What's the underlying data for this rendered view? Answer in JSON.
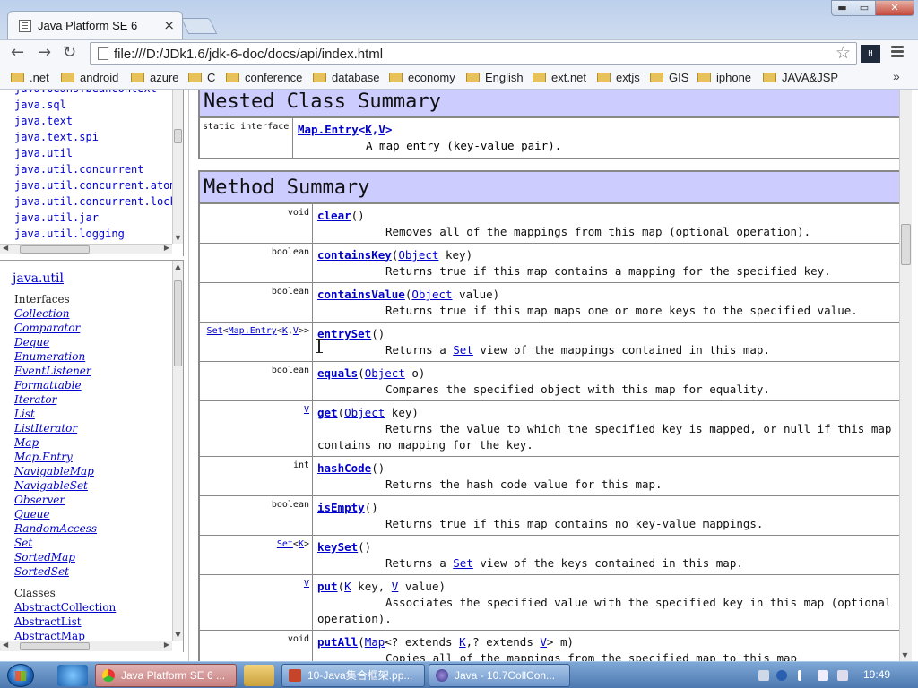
{
  "browser": {
    "tab_title": "Java Platform SE 6",
    "tab_close": "×",
    "url": "file:///D:/JDk1.6/jdk-6-doc/docs/api/index.html",
    "window_controls": {
      "min": "▬",
      "max": "▭",
      "close": "✕"
    },
    "nav": {
      "back": "←",
      "forward": "→",
      "reload": "↻"
    },
    "star": "☆",
    "ext_label": "H",
    "bookmarks": [
      ".net",
      "android",
      "azure",
      "C",
      "conference",
      "database",
      "economy",
      "English",
      "ext.net",
      "extjs",
      "GIS",
      "iphone",
      "JAVA&JSP"
    ],
    "bookmarks_more": "»"
  },
  "packages": {
    "items": [
      "java.beans.beancontext",
      "java.sql",
      "java.text",
      "java.text.spi",
      "java.util",
      "java.util.concurrent",
      "java.util.concurrent.atomic",
      "java.util.concurrent.locks",
      "java.util.jar",
      "java.util.logging"
    ]
  },
  "classes": {
    "package_title": "java.util",
    "interfaces_heading": "Interfaces",
    "interfaces": [
      "Collection",
      "Comparator",
      "Deque",
      "Enumeration",
      "EventListener",
      "Formattable",
      "Iterator",
      "List",
      "ListIterator",
      "Map",
      "Map.Entry",
      "NavigableMap",
      "NavigableSet",
      "Observer",
      "Queue",
      "RandomAccess",
      "Set",
      "SortedMap",
      "SortedSet"
    ],
    "classes_heading": "Classes",
    "classes": [
      "AbstractCollection",
      "AbstractList",
      "AbstractMap"
    ]
  },
  "nested": {
    "heading": "Nested Class Summary",
    "type": "static interface",
    "name": "Map.Entry",
    "generic_open": "<",
    "k": "K",
    "comma": ",",
    "v": "V",
    "generic_close": ">",
    "desc": "A map entry (key-value pair)."
  },
  "methods": {
    "heading": "Method Summary",
    "clear": {
      "type": "void",
      "name": "clear",
      "sig": "()",
      "desc": "Removes all of the mappings from this map (optional operation)."
    },
    "containsKey": {
      "type": "boolean",
      "name": "containsKey",
      "open": "(",
      "param_type": "Object",
      "rest": " key)",
      "desc1": "Returns ",
      "code": "true",
      "desc2": " if this map contains a mapping for the specified key."
    },
    "containsValue": {
      "type": "boolean",
      "name": "containsValue",
      "open": "(",
      "param_type": "Object",
      "rest": " value)",
      "desc1": "Returns ",
      "code": "true",
      "desc2": " if this map maps one or more keys to the specified value."
    },
    "entrySet": {
      "type_set": "Set",
      "type_lt": "<",
      "type_entry": "Map.Entry",
      "type_lt2": "<",
      "type_k": "K",
      "type_comma": ",",
      "type_v": "V",
      "type_gt": ">>",
      "name": "entrySet",
      "sig": "()",
      "desc1": "Returns a ",
      "desc_link": "Set",
      "desc2": " view of the mappings contained in this map."
    },
    "equals": {
      "type": "boolean",
      "name": "equals",
      "open": "(",
      "param_type": "Object",
      "rest": " o)",
      "desc": "Compares the specified object with this map for equality."
    },
    "get": {
      "type": "V",
      "name": "get",
      "open": "(",
      "param_type": "Object",
      "rest": " key)",
      "desc1": "Returns the value to which the specified key is mapped, or ",
      "code": "null",
      "desc2": " if this map contains no mapping for the key."
    },
    "hashCode": {
      "type": "int",
      "name": "hashCode",
      "sig": "()",
      "desc": "Returns the hash code value for this map."
    },
    "isEmpty": {
      "type": "boolean",
      "name": "isEmpty",
      "sig": "()",
      "desc1": "Returns ",
      "code": "true",
      "desc2": " if this map contains no key-value mappings."
    },
    "keySet": {
      "type_set": "Set",
      "type_lt": "<",
      "type_k": "K",
      "type_gt": ">",
      "name": "keySet",
      "sig": "()",
      "desc1": "Returns a ",
      "desc_link": "Set",
      "desc2": " view of the keys contained in this map."
    },
    "put": {
      "type": "V",
      "name": "put",
      "open": "(",
      "k": "K",
      "mid": " key, ",
      "v": "V",
      "rest": " value)",
      "desc": "Associates the specified value with the specified key in this map (optional operation)."
    },
    "putAll": {
      "type": "void",
      "name": "putAll",
      "open": "(",
      "map": "Map",
      "mid1": "<? extends ",
      "k": "K",
      "mid2": ",? extends ",
      "v": "V",
      "rest": "> m)",
      "desc": "Copies all of the mappings from the specified map to this map"
    }
  },
  "taskbar": {
    "items": [
      "Java Platform SE 6 ...",
      "10-Java集合框架.pp...",
      "Java - 10.7CollCon..."
    ],
    "clock": "19:49"
  }
}
